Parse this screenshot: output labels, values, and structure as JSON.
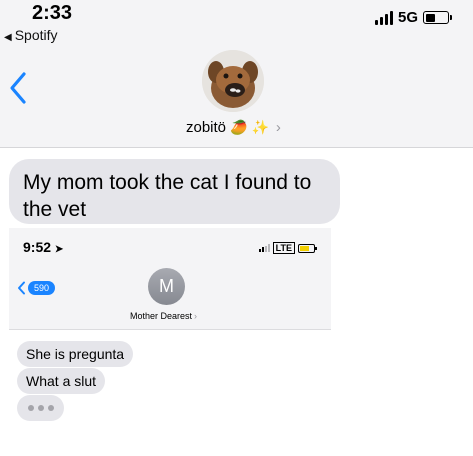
{
  "status_bar": {
    "time": "2:33",
    "network": "5G",
    "back_app_label": "Spotify"
  },
  "contact": {
    "name": "zobitö",
    "name_emoji": "🥭",
    "name_sparkle": "✨",
    "chevron": "›"
  },
  "messages": [
    {
      "from": "contact",
      "text": "My mom took the cat I found to the vet"
    }
  ],
  "embedded_screenshot": {
    "time": "9:52",
    "location_arrow": "➤",
    "network": "LTE",
    "back_badge": "590",
    "avatar_initial": "M",
    "contact_name": "Mother Dearest",
    "chevron": "›",
    "messages": [
      {
        "text": "She is pregunta"
      },
      {
        "text": "What a slut"
      }
    ],
    "typing_indicator": true
  },
  "colors": {
    "ios_blue": "#1a84ff",
    "bubble_gray": "#e5e5ea",
    "header_bg": "#f4f4f6"
  }
}
